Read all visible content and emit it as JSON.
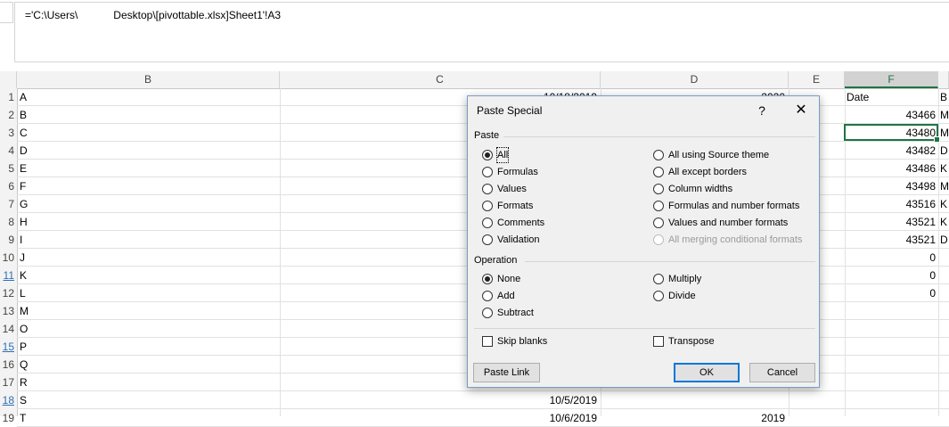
{
  "formula_bar": {
    "text": "='C:\\Users\\            Desktop\\[pivottable.xlsx]Sheet1'!A3"
  },
  "columns": [
    "B",
    "C",
    "D",
    "E",
    "F"
  ],
  "rows": [
    {
      "num": "1",
      "b": "A",
      "c": "10/18/2019",
      "d": "2020",
      "f": "Date",
      "g": "B"
    },
    {
      "num": "2",
      "b": "B",
      "c": "",
      "d": "",
      "f": "43466",
      "g": "M"
    },
    {
      "num": "3",
      "b": "C",
      "c": "",
      "d": "",
      "f": "43480",
      "g": "M"
    },
    {
      "num": "4",
      "b": "D",
      "c": "",
      "d": "",
      "f": "43482",
      "g": "D"
    },
    {
      "num": "5",
      "b": "E",
      "c": "",
      "d": "",
      "f": "43486",
      "g": "K"
    },
    {
      "num": "6",
      "b": "F",
      "c": "",
      "d": "",
      "f": "43498",
      "g": "M"
    },
    {
      "num": "7",
      "b": "G",
      "c": "",
      "d": "",
      "f": "43516",
      "g": "K"
    },
    {
      "num": "8",
      "b": "H",
      "c": "",
      "d": "",
      "f": "43521",
      "g": "K"
    },
    {
      "num": "9",
      "b": "I",
      "c": "",
      "d": "",
      "f": "43521",
      "g": "D"
    },
    {
      "num": "10",
      "b": "J",
      "c": "",
      "d": "",
      "f": "0",
      "g": ""
    },
    {
      "num": "11",
      "b": "K",
      "c": "",
      "d": "",
      "f": "0",
      "g": ""
    },
    {
      "num": "12",
      "b": "L",
      "c": "",
      "d": "",
      "f": "0",
      "g": ""
    },
    {
      "num": "13",
      "b": "M",
      "c": "",
      "d": "",
      "f": "",
      "g": ""
    },
    {
      "num": "14",
      "b": "O",
      "c": "",
      "d": "",
      "f": "",
      "g": ""
    },
    {
      "num": "15",
      "b": "P",
      "c": "",
      "d": "",
      "f": "",
      "g": ""
    },
    {
      "num": "16",
      "b": "Q",
      "c": "",
      "d": "",
      "f": "",
      "g": ""
    },
    {
      "num": "17",
      "b": "R",
      "c": "",
      "d": "",
      "f": "",
      "g": ""
    },
    {
      "num": "18",
      "b": "S",
      "c": "10/5/2019",
      "d": "",
      "f": "",
      "g": ""
    },
    {
      "num": "19",
      "b": "T",
      "c": "10/6/2019",
      "d": "2019",
      "f": "",
      "g": ""
    }
  ],
  "dialog": {
    "title": "Paste Special",
    "help": "?",
    "close": "✕",
    "paste_group": "Paste",
    "paste_left": [
      "All",
      "Formulas",
      "Values",
      "Formats",
      "Comments",
      "Validation"
    ],
    "paste_right": [
      "All using Source theme",
      "All except borders",
      "Column widths",
      "Formulas and number formats",
      "Values and number formats",
      "All merging conditional formats"
    ],
    "operation_group": "Operation",
    "op_left": [
      "None",
      "Add",
      "Subtract"
    ],
    "op_right": [
      "Multiply",
      "Divide"
    ],
    "skip_blanks": "Skip blanks",
    "transpose": "Transpose",
    "paste_link": "Paste Link",
    "ok": "OK",
    "cancel": "Cancel"
  }
}
